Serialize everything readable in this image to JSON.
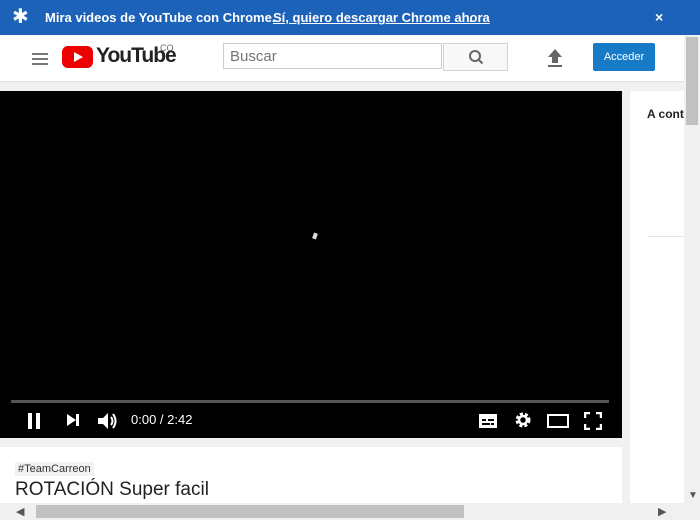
{
  "banner": {
    "text": "Mira videos de YouTube con Chrome.",
    "link": "Sí, quiero descargar Chrome ahora",
    "period": ".",
    "close": "×",
    "star": "✱"
  },
  "masthead": {
    "logo_text": "YouTube",
    "country": "CO",
    "search_placeholder": "Buscar",
    "signin_label": "Acceder",
    "icons": [
      "menu-icon",
      "youtube-logo",
      "search-icon",
      "upload-icon"
    ]
  },
  "player": {
    "time": "0:00 / 2:42",
    "progress": 0,
    "controls": [
      "pause-icon",
      "next-icon",
      "volume-icon",
      "subtitles-icon",
      "gear-icon",
      "theater-mode-icon",
      "fullscreen-icon"
    ]
  },
  "side": {
    "title": "A cont"
  },
  "video": {
    "hashtag": "#TeamCarreon",
    "title": "ROTACIÓN Super facil"
  },
  "colors": {
    "banner": "#1c62b9",
    "brand_red": "#ee0000",
    "signin": "#167ac6"
  }
}
